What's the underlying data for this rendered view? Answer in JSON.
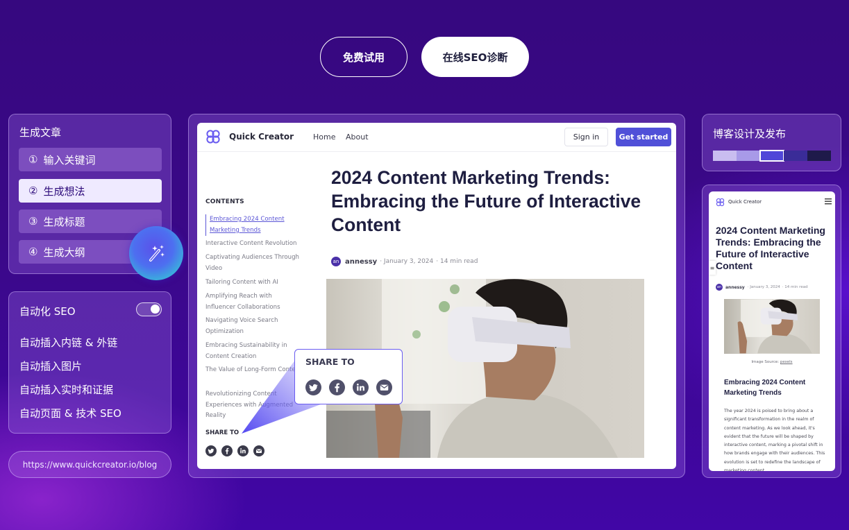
{
  "top_buttons": {
    "trial_label": "免费试用",
    "seo_check_label": "在线SEO诊断"
  },
  "generate_panel": {
    "title": "生成文章",
    "steps": [
      {
        "num": "①",
        "label": "输入关键词",
        "active": false
      },
      {
        "num": "②",
        "label": "生成想法",
        "active": true
      },
      {
        "num": "③",
        "label": "生成标题",
        "active": false
      },
      {
        "num": "④",
        "label": "生成大纲",
        "active": false
      }
    ],
    "magic_icon": "magic-wand-icon"
  },
  "seo_panel": {
    "title": "自动化 SEO",
    "toggle_on": true,
    "items": [
      "自动插入内链 & 外链",
      "自动插入图片",
      "自动插入实时和证据",
      "自动页面 & 技术 SEO"
    ]
  },
  "blog_url": "https://www.quickcreator.io/blog",
  "desktop_preview": {
    "brand": "Quick Creator",
    "nav_links": [
      "Home",
      "About"
    ],
    "signin_label": "Sign in",
    "get_started_label": "Get started",
    "toc_title": "CONTENTS",
    "toc_items": [
      {
        "text": "Embracing 2024 Content Marketing Trends",
        "active": true
      },
      {
        "text": "Interactive Content Revolution",
        "active": false
      },
      {
        "text": "Captivating Audiences Through Video",
        "active": false
      },
      {
        "text": "Tailoring Content with AI",
        "active": false
      },
      {
        "text": "Amplifying Reach with Influencer Collaborations",
        "active": false
      },
      {
        "text": "Navigating Voice Search Optimization",
        "active": false
      },
      {
        "text": "Embracing Sustainability in Content Creation",
        "active": false
      },
      {
        "text": "The Value of Long-Form Content",
        "active": false
      },
      {
        "text": "Revolutionizing Content Experiences with Augmented Reality",
        "active": false
      }
    ],
    "share_title": "SHARE TO",
    "share_icons": [
      "twitter-icon",
      "facebook-icon",
      "linkedin-icon",
      "email-icon"
    ],
    "article_title": "2024 Content Marketing Trends: Embracing the Future of Interactive Content",
    "avatar_initials": "an",
    "author": "annessy",
    "date": "· January 3, 2024",
    "read_time": "· 14 min read",
    "hero_alt": "Person wearing a VR headset pointing at the air"
  },
  "share_popup": {
    "title": "SHARE TO"
  },
  "blog_design_panel": {
    "title": "博客设计及发布",
    "swatches": [
      {
        "color": "#c9bdf0",
        "selected": false
      },
      {
        "color": "#a89ae8",
        "selected": false
      },
      {
        "color": "#5046d8",
        "selected": true
      },
      {
        "color": "#3a2c98",
        "selected": false
      },
      {
        "color": "#1e1a4a",
        "selected": false
      }
    ]
  },
  "mobile_preview": {
    "brand": "Quick Creator",
    "article_title": "2024 Content Marketing Trends: Embracing the Future of Interactive Content",
    "avatar_initials": "an",
    "author": "annessy",
    "date": "· January 3, 2024",
    "read_time": "· 14 min read",
    "caption_prefix": "Image Source: ",
    "caption_link": "pexels",
    "section_title": "Embracing 2024 Content Marketing Trends",
    "body": "The year 2024 is poised to bring about a significant transformation in the realm of content marketing. As we look ahead, it's evident that the future will be shaped by interactive content, marking a pivotal shift in how brands engage with their audiences. This evolution is set to redefine the landscape of marketing content."
  }
}
